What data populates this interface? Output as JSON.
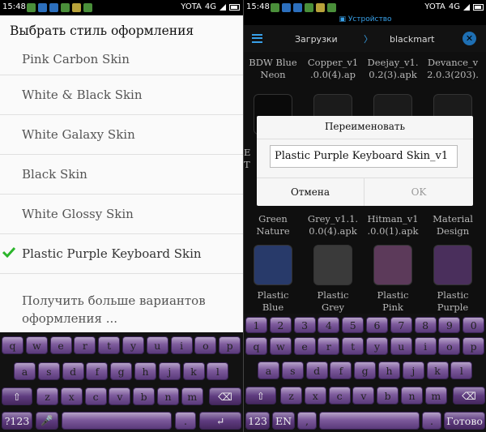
{
  "left": {
    "status": {
      "time": "15:48",
      "carrier": "YOTA",
      "network": "4G"
    },
    "title": "Выбрать стиль оформления",
    "options": [
      "Pink Carbon Skin",
      "White & Black Skin",
      "White Galaxy Skin",
      "Black Skin",
      "White Glossy Skin",
      "Plastic Purple Keyboard Skin"
    ],
    "selected_index": 5,
    "more_line1": "Получить больше вариантов",
    "more_line2": "оформления ..."
  },
  "right": {
    "status": {
      "time": "15:48",
      "carrier": "YOTA",
      "network": "4G"
    },
    "tab": "Устройство",
    "toolbar": {
      "path1": "Загрузки",
      "separator": "〉",
      "path2": "blackmart"
    },
    "files": [
      {
        "line1": "BDW Blue",
        "line2": "Neon"
      },
      {
        "line1": "Copper_v1",
        "line2": ".0.0(4).ap"
      },
      {
        "line1": "Deejay_v1.",
        "line2": "0.2(3).apk"
      },
      {
        "line1": "Devance_v",
        "line2": "2.0.3(203)."
      },
      {
        "line1": "Green",
        "line2": "Nature"
      },
      {
        "line1": "Grey_v1.1.",
        "line2": "0.0(4).apk"
      },
      {
        "line1": "Hitman_v1",
        "line2": ".0.0(1).apk"
      },
      {
        "line1": "Material",
        "line2": "Design"
      },
      {
        "line1": "Plastic",
        "line2": "Blue"
      },
      {
        "line1": "Plastic",
        "line2": "Grey"
      },
      {
        "line1": "Plastic",
        "line2": "Pink"
      },
      {
        "line1": "Plastic",
        "line2": "Purple"
      }
    ],
    "partial_labels": {
      "a": "E",
      "b": "T"
    },
    "dialog": {
      "title": "Переименовать",
      "value": "Plastic Purple Keyboard Skin_v1",
      "cancel": "Отмена",
      "ok": "OK"
    }
  },
  "keyboard_left": {
    "row1": [
      "q",
      "w",
      "e",
      "r",
      "t",
      "y",
      "u",
      "i",
      "o",
      "p"
    ],
    "row2": [
      "a",
      "s",
      "d",
      "f",
      "g",
      "h",
      "j",
      "k",
      "l"
    ],
    "row3": [
      "z",
      "x",
      "c",
      "v",
      "b",
      "n",
      "m"
    ],
    "sym": "?123",
    "dot": "."
  },
  "keyboard_right": {
    "numbers": [
      "1",
      "2",
      "3",
      "4",
      "5",
      "6",
      "7",
      "8",
      "9",
      "0"
    ],
    "row1": [
      "q",
      "w",
      "e",
      "r",
      "t",
      "y",
      "u",
      "i",
      "o",
      "p"
    ],
    "row2": [
      "a",
      "s",
      "d",
      "f",
      "g",
      "h",
      "j",
      "k",
      "l"
    ],
    "row3": [
      "z",
      "x",
      "c",
      "v",
      "b",
      "n",
      "m"
    ],
    "sym": "123",
    "lang": "EN",
    "comma": ",",
    "dot": ".",
    "go": "Готово"
  },
  "colors": {
    "check": "#2bb52b",
    "accent": "#38a0e8",
    "key_purple": "#6b4a8d"
  }
}
